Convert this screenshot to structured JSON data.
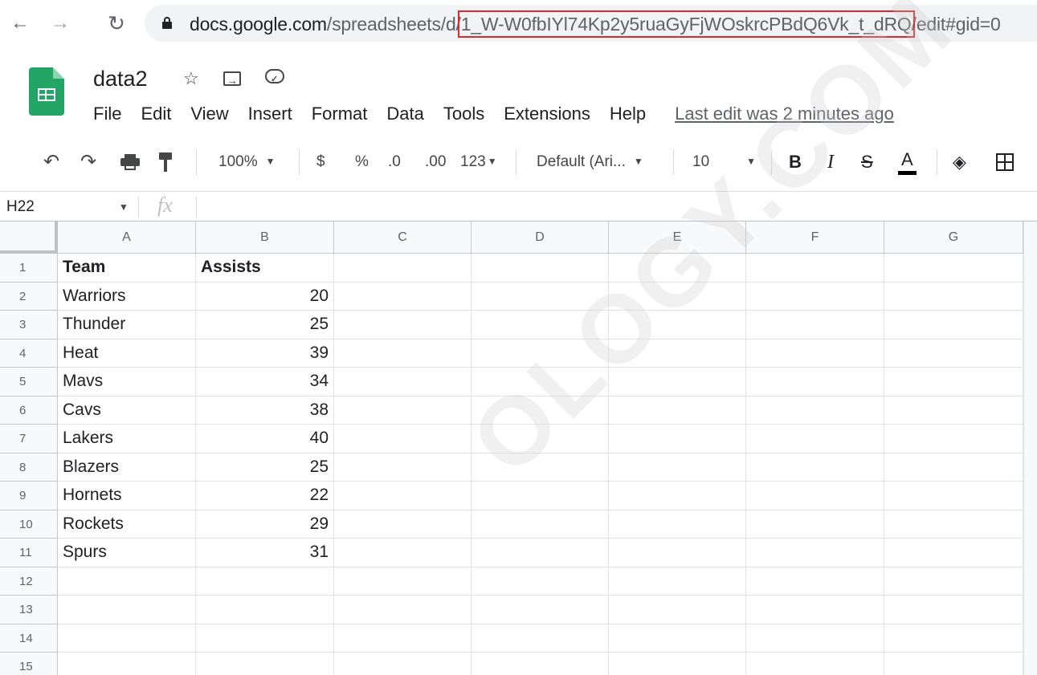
{
  "browser": {
    "url_host": "docs.google.com",
    "url_path_prefix": "/spreadsheets/d/",
    "url_highlight": "1_W-W0fbIYl74Kp2y5ruaGyFjWOskrcPBdQ6Vk_t_dRQ",
    "url_suffix": "/edit#gid=0",
    "icons": {
      "back": "arrow-left-icon",
      "forward": "arrow-right-icon",
      "reload": "reload-icon",
      "lock": "lock-icon"
    }
  },
  "doc": {
    "title": "data2",
    "icons": {
      "star": "star-icon",
      "move": "move-to-folder-icon",
      "cloud": "cloud-saved-icon"
    }
  },
  "menu": {
    "items": [
      "File",
      "Edit",
      "View",
      "Insert",
      "Format",
      "Data",
      "Tools",
      "Extensions",
      "Help"
    ],
    "last_edit": "Last edit was 2 minutes ago"
  },
  "toolbar": {
    "zoom": "100%",
    "currency": "$",
    "percent": "%",
    "decrease_decimal": ".0",
    "increase_decimal": ".00",
    "more_formats": "123",
    "font": "Default (Ari...",
    "font_size": "10",
    "bold": "B",
    "italic": "I",
    "strikethrough": "S",
    "text_color": "A",
    "colors": {
      "text_color_bar": "#000000",
      "url_highlight_box": "#e0282f",
      "sheets_green": "#23a566"
    }
  },
  "formula_bar": {
    "cell_ref": "H22",
    "fx": "fx"
  },
  "sheet": {
    "columns": [
      "A",
      "B",
      "C",
      "D",
      "E",
      "F",
      "G"
    ],
    "rows": [
      "1",
      "2",
      "3",
      "4",
      "5",
      "6",
      "7",
      "8",
      "9",
      "10",
      "11",
      "12",
      "13",
      "14",
      "15"
    ],
    "header": {
      "team": "Team",
      "assists": "Assists"
    },
    "data": [
      {
        "team": "Warriors",
        "assists": "20"
      },
      {
        "team": "Thunder",
        "assists": "25"
      },
      {
        "team": "Heat",
        "assists": "39"
      },
      {
        "team": "Mavs",
        "assists": "34"
      },
      {
        "team": "Cavs",
        "assists": "38"
      },
      {
        "team": "Lakers",
        "assists": "40"
      },
      {
        "team": "Blazers",
        "assists": "25"
      },
      {
        "team": "Hornets",
        "assists": "22"
      },
      {
        "team": "Rockets",
        "assists": "29"
      },
      {
        "team": "Spurs",
        "assists": "31"
      }
    ]
  },
  "watermark": "OLOGY.COM"
}
